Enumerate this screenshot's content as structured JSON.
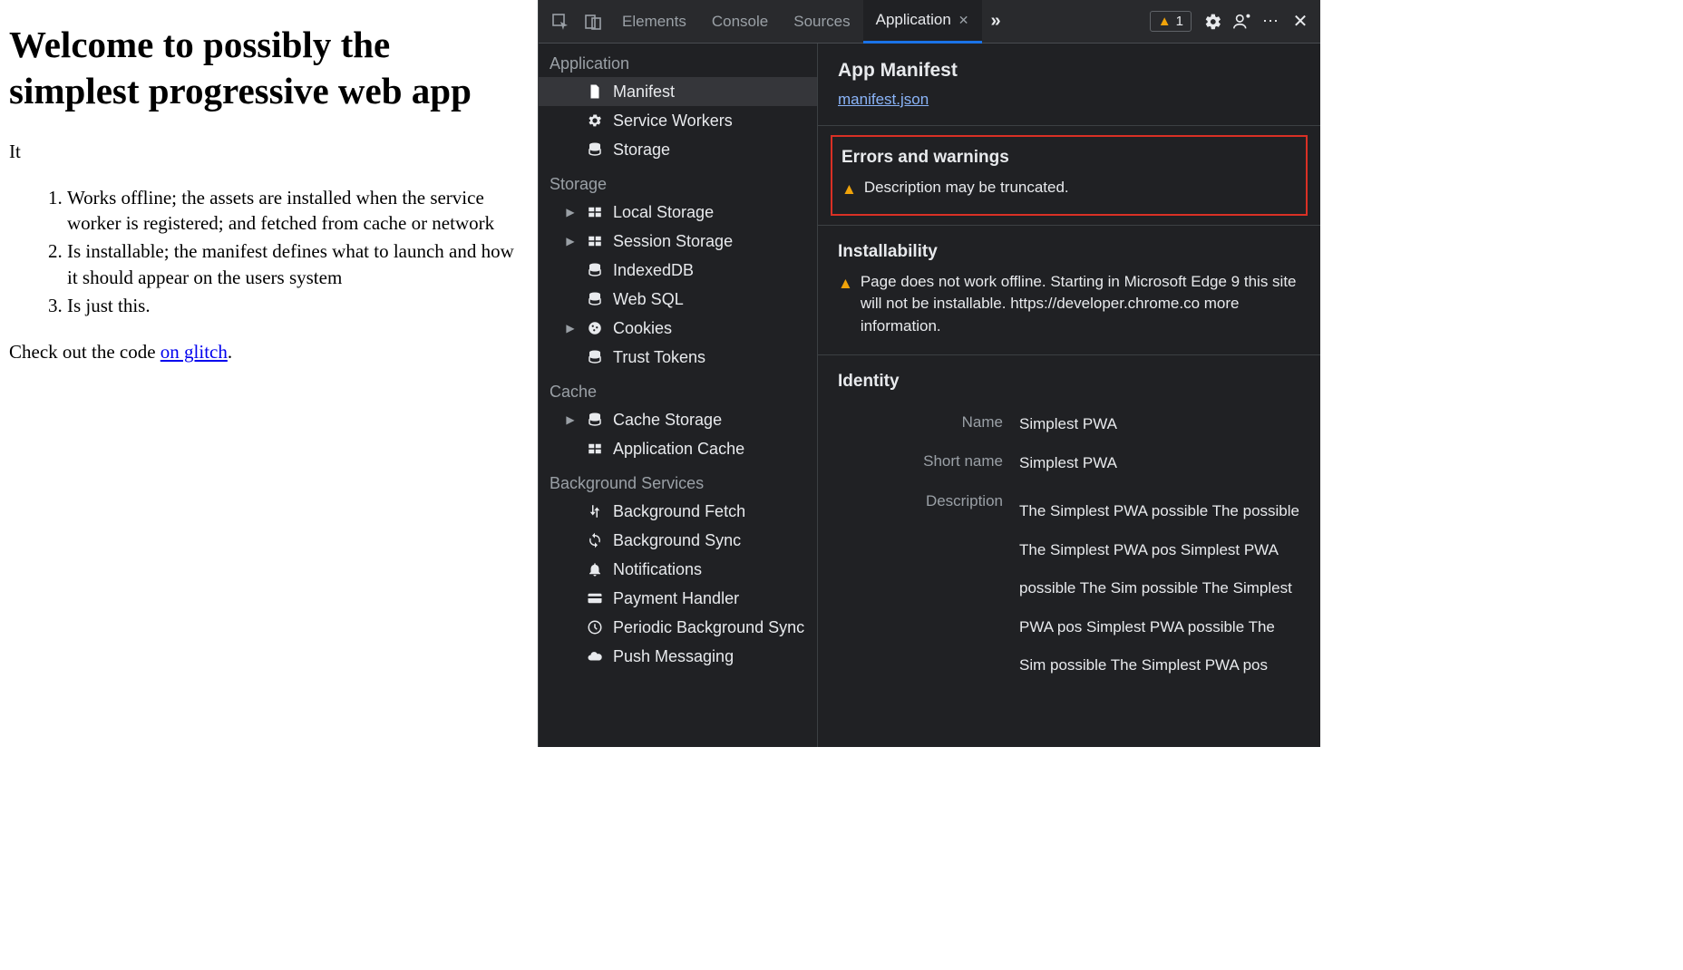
{
  "page": {
    "heading": "Welcome to possibly the simplest progressive web app",
    "intro": "It",
    "items": [
      "Works offline; the assets are installed when the service worker is registered; and fetched from cache or network",
      "Is installable; the manifest defines what to launch and how it should appear on the users system",
      "Is just this."
    ],
    "footer_pre": "Check out the code ",
    "footer_link": "on glitch",
    "footer_post": "."
  },
  "devtools": {
    "tabs": [
      "Elements",
      "Console",
      "Sources",
      "Application"
    ],
    "active_tab": "Application",
    "warn_count": "1",
    "sidebar": {
      "sections": [
        {
          "title": "Application",
          "items": [
            {
              "label": "Manifest",
              "icon": "file-icon",
              "selected": true
            },
            {
              "label": "Service Workers",
              "icon": "gear-icon"
            },
            {
              "label": "Storage",
              "icon": "db-icon"
            }
          ]
        },
        {
          "title": "Storage",
          "items": [
            {
              "label": "Local Storage",
              "icon": "grid-icon",
              "caret": true
            },
            {
              "label": "Session Storage",
              "icon": "grid-icon",
              "caret": true
            },
            {
              "label": "IndexedDB",
              "icon": "db-icon"
            },
            {
              "label": "Web SQL",
              "icon": "db-icon"
            },
            {
              "label": "Cookies",
              "icon": "cookie-icon",
              "caret": true
            },
            {
              "label": "Trust Tokens",
              "icon": "db-icon"
            }
          ]
        },
        {
          "title": "Cache",
          "items": [
            {
              "label": "Cache Storage",
              "icon": "db-icon",
              "caret": true
            },
            {
              "label": "Application Cache",
              "icon": "grid-icon"
            }
          ]
        },
        {
          "title": "Background Services",
          "items": [
            {
              "label": "Background Fetch",
              "icon": "transfer-icon"
            },
            {
              "label": "Background Sync",
              "icon": "sync-icon"
            },
            {
              "label": "Notifications",
              "icon": "bell-icon"
            },
            {
              "label": "Payment Handler",
              "icon": "card-icon"
            },
            {
              "label": "Periodic Background Sync",
              "icon": "clock-icon"
            },
            {
              "label": "Push Messaging",
              "icon": "cloud-icon"
            }
          ]
        }
      ]
    },
    "content": {
      "manifest_title": "App Manifest",
      "manifest_link": "manifest.json",
      "errors_title": "Errors and warnings",
      "errors_warn": "Description may be truncated.",
      "install_title": "Installability",
      "install_warn": "Page does not work offline. Starting in Microsoft Edge 9 this site will not be installable. https://developer.chrome.co more information.",
      "identity_title": "Identity",
      "identity": {
        "name_label": "Name",
        "name_val": "Simplest PWA",
        "short_label": "Short name",
        "short_val": "Simplest PWA",
        "desc_label": "Description",
        "desc_val": "The Simplest PWA possible The possible The Simplest PWA pos Simplest PWA possible The Sim possible The Simplest PWA pos Simplest PWA possible The Sim possible The Simplest PWA pos"
      }
    }
  }
}
